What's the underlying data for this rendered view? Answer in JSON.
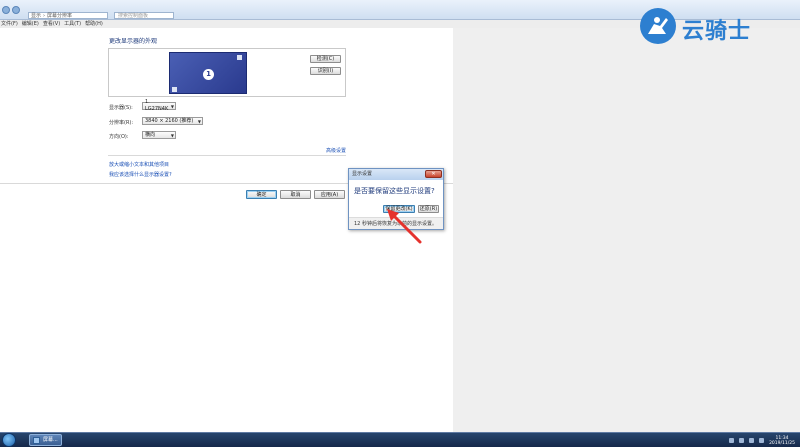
{
  "address": {
    "crumbs": [
      "显示",
      "屏幕分辨率"
    ],
    "search_placeholder": "搜索控制面板"
  },
  "menu": [
    "文件(F)",
    "编辑(E)",
    "查看(V)",
    "工具(T)",
    "帮助(H)"
  ],
  "page": {
    "title": "更改显示器的外观",
    "monitor_number": "1",
    "detect_label": "检测(C)",
    "identify_label": "识别(I)"
  },
  "settings": {
    "display_label": "显示器(S):",
    "display_value": "1. LG27N4K",
    "resolution_label": "分辨率(R):",
    "resolution_value": "3840 × 2160 (推荐)",
    "orientation_label": "方向(O):",
    "orientation_value": "横向",
    "advanced_link": "高级设置"
  },
  "links": {
    "enlarge": "放大或缩小文本和其他项目",
    "which_settings": "我应该选择什么显示器设置?"
  },
  "footer": {
    "ok": "确定",
    "cancel": "取消",
    "apply": "应用(A)"
  },
  "dialog": {
    "title": "显示设置",
    "close": "✕",
    "question": "是否要保留这些显示设置?",
    "keep": "保留更改(K)",
    "revert": "还原(R)",
    "status": "12 秒钟后将恢复为以前的显示设置。"
  },
  "watermark": {
    "text": "云骑士"
  },
  "taskbar": {
    "active_label": "屏幕...",
    "time": "11:34",
    "date": "2019/11/25"
  },
  "colors": {
    "link": "#1a4fb5",
    "title": "#1e3a7b",
    "monitor": "#2a3a8e",
    "arrow": "#e5322d",
    "watermark": "#2d7fd0"
  }
}
